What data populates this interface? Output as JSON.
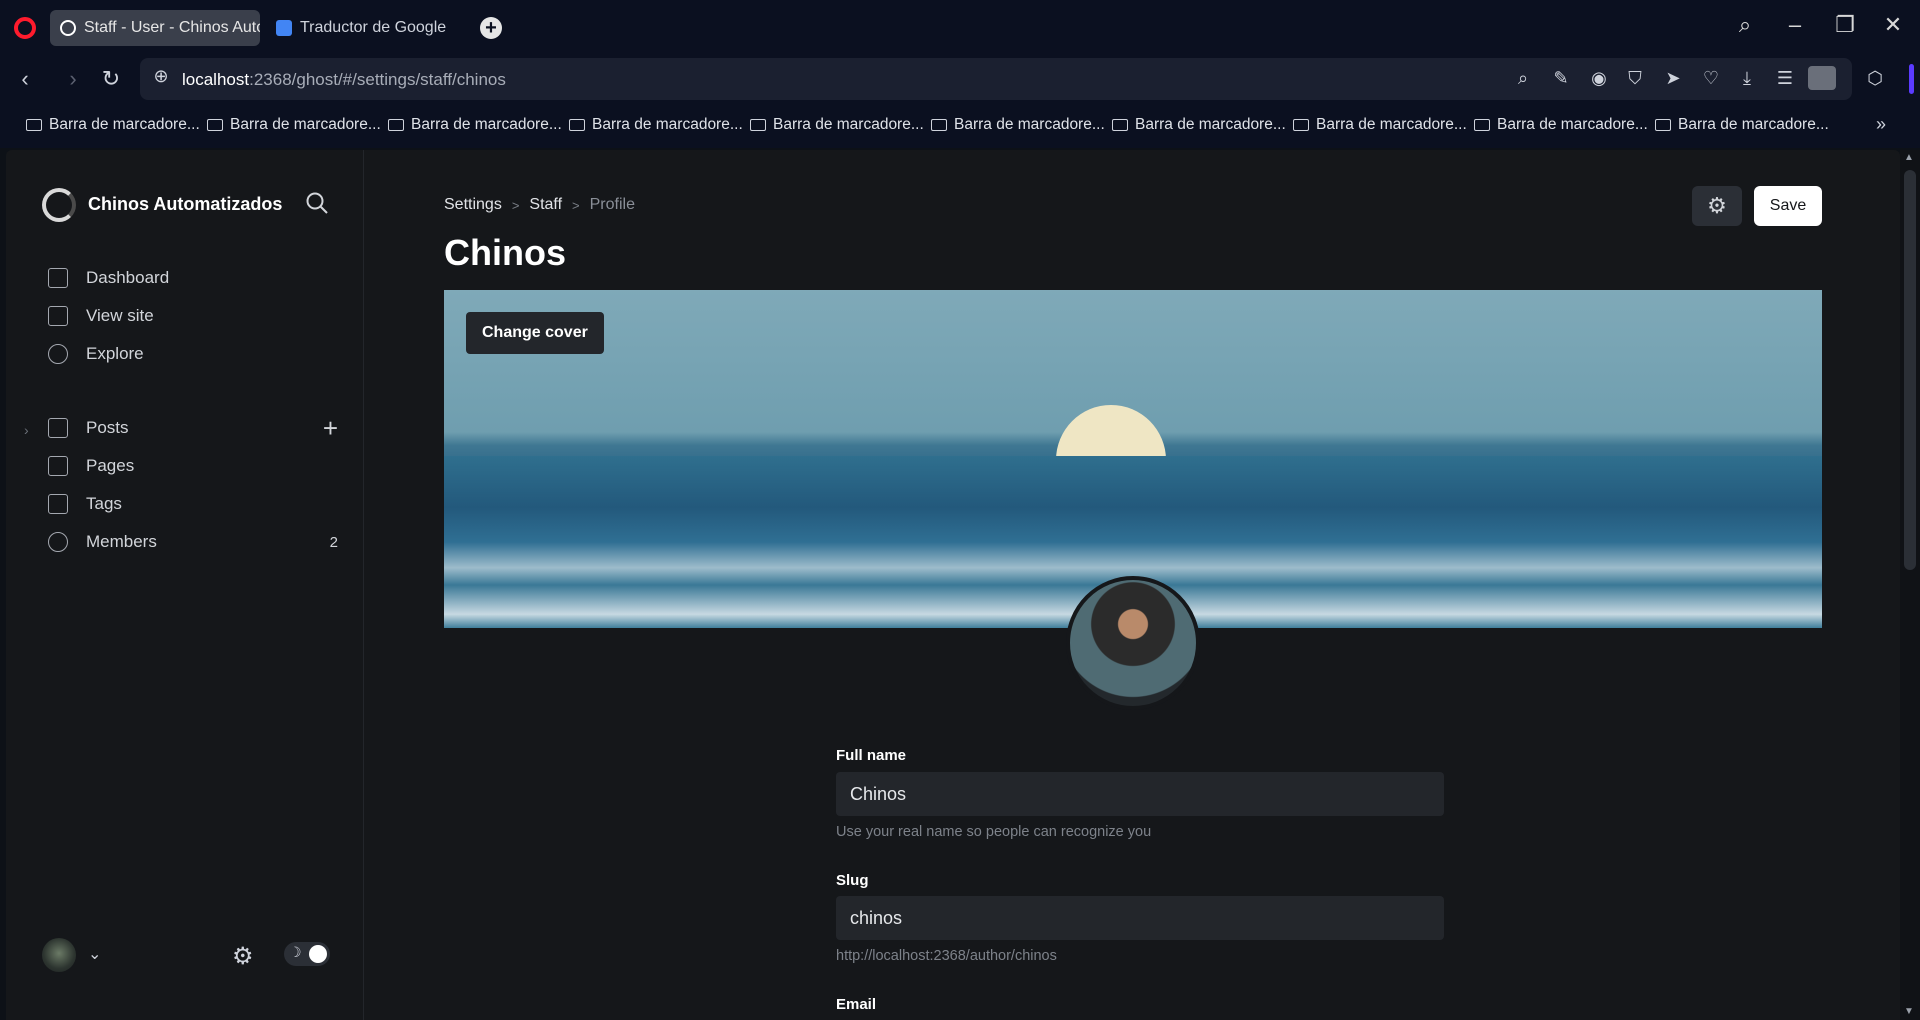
{
  "browser": {
    "tabs": [
      {
        "title": "Staff - User - Chinos Auto"
      },
      {
        "title": "Traductor de Google"
      }
    ],
    "url_host": "localhost",
    "url_path": ":2368/ghost/#/settings/staff/chinos",
    "bookmarks": [
      "Barra de marcadore...",
      "Barra de marcadore...",
      "Barra de marcadore...",
      "Barra de marcadore...",
      "Barra de marcadore...",
      "Barra de marcadore...",
      "Barra de marcadore...",
      "Barra de marcadore...",
      "Barra de marcadore...",
      "Barra de marcadore..."
    ]
  },
  "sidebar": {
    "site_name": "Chinos Automatizados",
    "items": [
      {
        "label": "Dashboard",
        "icon": "home-icon"
      },
      {
        "label": "View site",
        "icon": "layout-icon"
      },
      {
        "label": "Explore",
        "icon": "globe-icon"
      },
      {
        "label": "Posts",
        "icon": "edit-icon"
      },
      {
        "label": "Pages",
        "icon": "pages-icon"
      },
      {
        "label": "Tags",
        "icon": "tag-icon"
      },
      {
        "label": "Members",
        "icon": "members-icon",
        "count": "2"
      }
    ]
  },
  "main": {
    "breadcrumb": {
      "settings": "Settings",
      "staff": "Staff",
      "current": "Profile"
    },
    "title": "Chinos",
    "save_label": "Save",
    "change_cover_label": "Change cover",
    "fields": {
      "full_name_label": "Full name",
      "full_name_value": "Chinos",
      "full_name_hint": "Use your real name so people can recognize you",
      "slug_label": "Slug",
      "slug_value": "chinos",
      "slug_hint": "http://localhost:2368/author/chinos",
      "email_label": "Email"
    }
  },
  "colors": {
    "accent_browser": "#ff1b2d",
    "background": "#15171a",
    "save_button": "#ffffff"
  }
}
